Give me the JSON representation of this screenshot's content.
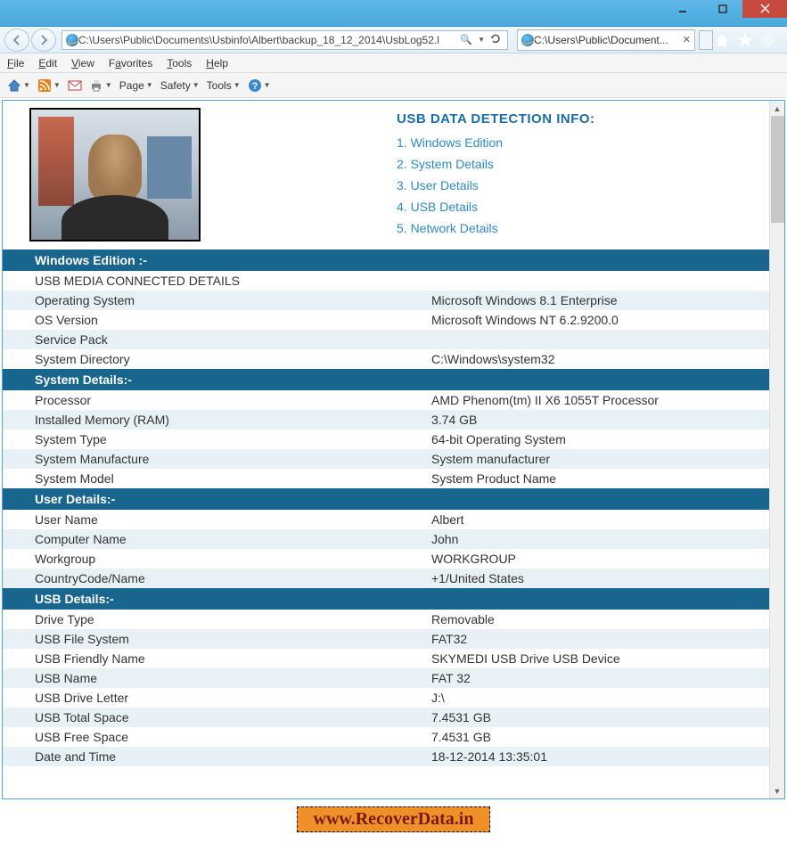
{
  "address_bar": "C:\\Users\\Public\\Documents\\Usbinfo\\Albert\\backup_18_12_2014\\UsbLog52.l",
  "tab_title": "C:\\Users\\Public\\Document...",
  "menu": {
    "file": "File",
    "edit": "Edit",
    "view": "View",
    "favorites": "Favorites",
    "tools": "Tools",
    "help": "Help"
  },
  "toolbar": {
    "page": "Page",
    "safety": "Safety",
    "tools": "Tools"
  },
  "header": {
    "title": "USB DATA DETECTION INFO:",
    "links": [
      "1. Windows Edition",
      "2. System Details",
      "3. User Details",
      "4. USB Details",
      "5. Network Details"
    ]
  },
  "sections": [
    {
      "title": "Windows Edition :-",
      "rows": [
        {
          "k": "USB MEDIA CONNECTED DETAILS",
          "v": ""
        },
        {
          "k": "Operating System",
          "v": "Microsoft Windows 8.1 Enterprise"
        },
        {
          "k": "OS Version",
          "v": "Microsoft Windows NT 6.2.9200.0"
        },
        {
          "k": "Service Pack",
          "v": ""
        },
        {
          "k": "System Directory",
          "v": "C:\\Windows\\system32"
        }
      ]
    },
    {
      "title": "System Details:-",
      "rows": [
        {
          "k": "Processor",
          "v": "AMD Phenom(tm) II X6 1055T Processor"
        },
        {
          "k": "Installed Memory (RAM)",
          "v": "3.74 GB"
        },
        {
          "k": "System Type",
          "v": "64-bit Operating System"
        },
        {
          "k": "System Manufacture",
          "v": "System manufacturer"
        },
        {
          "k": "System Model",
          "v": "System Product Name"
        }
      ]
    },
    {
      "title": "User Details:-",
      "rows": [
        {
          "k": "User Name",
          "v": "Albert"
        },
        {
          "k": "Computer Name",
          "v": "John"
        },
        {
          "k": "Workgroup",
          "v": "WORKGROUP"
        },
        {
          "k": "CountryCode/Name",
          "v": "+1/United States"
        }
      ]
    },
    {
      "title": "USB Details:-",
      "rows": [
        {
          "k": "Drive Type",
          "v": "Removable"
        },
        {
          "k": "USB File System",
          "v": "FAT32"
        },
        {
          "k": "USB Friendly Name",
          "v": "SKYMEDI USB Drive USB Device"
        },
        {
          "k": "USB Name",
          "v": "FAT 32"
        },
        {
          "k": "USB Drive Letter",
          "v": "J:\\"
        },
        {
          "k": "USB Total Space",
          "v": "7.4531 GB"
        },
        {
          "k": "USB Free Space",
          "v": "7.4531 GB"
        },
        {
          "k": "Date and Time",
          "v": "18-12-2014 13:35:01"
        }
      ]
    }
  ],
  "footer": "www.RecoverData.in"
}
